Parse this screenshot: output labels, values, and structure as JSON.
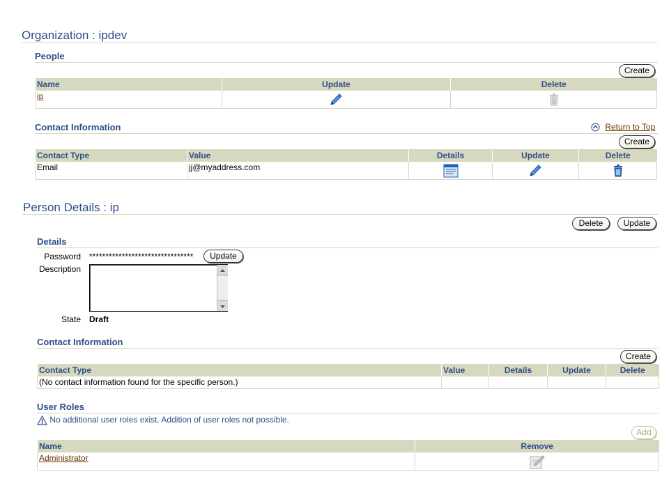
{
  "org": {
    "title": "Organization : ipdev",
    "people": {
      "heading": "People",
      "create_label": "Create",
      "columns": [
        "Name",
        "Update",
        "Delete"
      ],
      "rows": [
        {
          "name": "ip"
        }
      ]
    },
    "contact": {
      "heading": "Contact Information",
      "return_top": "Return to Top",
      "create_label": "Create",
      "columns": [
        "Contact Type",
        "Value",
        "Details",
        "Update",
        "Delete"
      ],
      "rows": [
        {
          "type": "Email",
          "value": "jj@myaddress.com"
        }
      ]
    }
  },
  "person": {
    "title": "Person Details : ip",
    "delete_label": "Delete",
    "update_label": "Update",
    "details": {
      "heading": "Details",
      "password_label": "Password",
      "password_value": "********************************",
      "password_update_label": "Update",
      "description_label": "Description",
      "description_value": "",
      "state_label": "State",
      "state_value": "Draft"
    },
    "contact": {
      "heading": "Contact Information",
      "create_label": "Create",
      "columns": [
        "Contact Type",
        "Value",
        "Details",
        "Update",
        "Delete"
      ],
      "empty_text": "(No contact information found for the specific person.)"
    },
    "roles": {
      "heading": "User Roles",
      "warning": "No additional user roles exist. Addition of user roles not possible.",
      "add_label": "Add",
      "columns": [
        "Name",
        "Remove"
      ],
      "rows": [
        {
          "name": "Administrator"
        }
      ]
    }
  },
  "colors": {
    "heading": "#2e4e88",
    "rule": "#d7d8c0",
    "link": "#663300",
    "icon_blue": "#1f5fb4"
  },
  "icons": [
    "pencil-icon",
    "trash-icon",
    "details-icon",
    "warning-icon",
    "return-top-icon",
    "remove-role-icon"
  ]
}
